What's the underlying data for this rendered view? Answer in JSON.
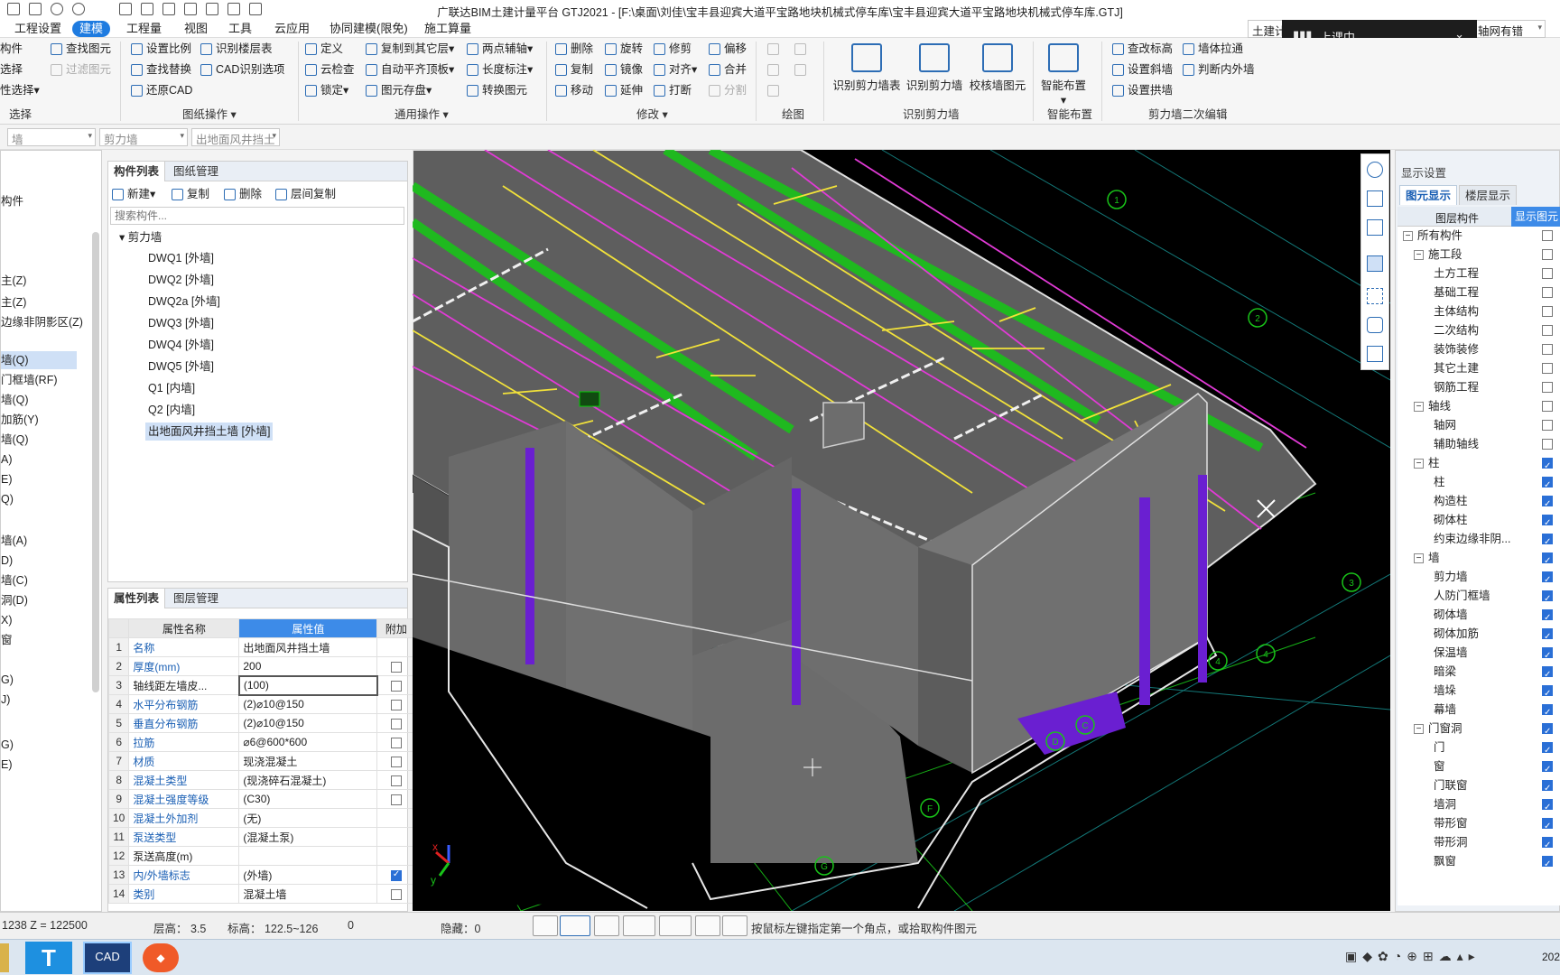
{
  "app": {
    "title": "广联达BIM土建计量平台 GTJ2021 - [F:\\桌面\\刘佳\\宝丰县迎宾大道平宝路地块机械式停车库\\宝丰县迎宾大道平宝路地块机械式停车库.GTJ]"
  },
  "menu": [
    "工程设置",
    "建模",
    "工程量",
    "视图",
    "工具",
    "云应用",
    "协同建模(限免)",
    "施工算量"
  ],
  "menu_active": "建模",
  "right_selectors": {
    "a": "土建计",
    "b": "轴网有错"
  },
  "meeting": {
    "label": "上课中"
  },
  "ribbon": {
    "select_group": {
      "items": [
        "构件",
        "选择",
        "性选择"
      ],
      "label": "选择",
      "find": "查找图元",
      "filter": "过滤图元"
    },
    "drawing_ops": {
      "items": [
        "设置比例",
        "识别楼层表",
        "查找替换",
        "CAD识别选项",
        "还原CAD"
      ],
      "label": "图纸操作"
    },
    "common_ops": {
      "items": [
        "定义",
        "复制到其它层",
        "两点辅轴",
        "云检查",
        "自动平齐顶板",
        "长度标注",
        "锁定",
        "图元存盘",
        "转换图元"
      ],
      "label": "通用操作"
    },
    "modify": {
      "items": [
        "删除",
        "旋转",
        "修剪",
        "偏移",
        "复制",
        "镜像",
        "对齐",
        "合并",
        "移动",
        "延伸",
        "打断",
        "分割"
      ],
      "label": "修改"
    },
    "draw": {
      "label": "绘图"
    },
    "identify_shear": {
      "items": [
        "识别剪力墙表",
        "识别剪力墙",
        "校核墙图元"
      ],
      "label": "识别剪力墙"
    },
    "smart": {
      "items": [
        "智能布置"
      ],
      "label": "智能布置"
    },
    "shear_edit": {
      "items": [
        "查改标高",
        "墙体拉通",
        "设置斜墙",
        "判断内外墙",
        "设置拱墙"
      ],
      "label": "剪力墙二次编辑"
    }
  },
  "selbar": {
    "s1": "墙",
    "s2": "剪力墙",
    "s3": "出地面风井挡土"
  },
  "left_nav": [
    "构件",
    "主(Z)",
    "主(Z)",
    "边缘非阴影区(Z)",
    "墙(Q)",
    "门框墙(RF)",
    "墙(Q)",
    "加筋(Y)",
    "墙(Q)",
    "A)",
    "E)",
    "Q)",
    "墙(A)",
    "D)",
    "墙(C)",
    "洞(D)",
    "X)",
    "窗",
    "G)",
    "J)",
    "G)",
    "E)"
  ],
  "component_list": {
    "tabs": [
      "构件列表",
      "图纸管理"
    ],
    "toolbar": [
      "新建",
      "复制",
      "删除",
      "层间复制"
    ],
    "search_placeholder": "搜索构件...",
    "root": "剪力墙",
    "items": [
      "DWQ1 [外墙]",
      "DWQ2 [外墙]",
      "DWQ2a [外墙]",
      "DWQ3 [外墙]",
      "DWQ4 [外墙]",
      "DWQ5 [外墙]",
      "Q1 [内墙]",
      "Q2 [内墙]",
      "出地面风井挡土墙 [外墙]"
    ],
    "selected_index": 8
  },
  "properties": {
    "tabs": [
      "属性列表",
      "图层管理"
    ],
    "headers": [
      "属性名称",
      "属性值",
      "附加"
    ],
    "rows": [
      {
        "n": "1",
        "k": "名称",
        "v": "出地面风井挡土墙",
        "blue": true,
        "cb": null
      },
      {
        "n": "2",
        "k": "厚度(mm)",
        "v": "200",
        "blue": true,
        "cb": false
      },
      {
        "n": "3",
        "k": "轴线距左墙皮...",
        "v": "(100)",
        "blue": false,
        "cb": false
      },
      {
        "n": "4",
        "k": "水平分布钢筋",
        "v": "(2)⌀10@150",
        "blue": true,
        "cb": false
      },
      {
        "n": "5",
        "k": "垂直分布钢筋",
        "v": "(2)⌀10@150",
        "blue": true,
        "cb": false
      },
      {
        "n": "6",
        "k": "拉筋",
        "v": "⌀6@600*600",
        "blue": true,
        "cb": false
      },
      {
        "n": "7",
        "k": "材质",
        "v": "现浇混凝土",
        "blue": true,
        "cb": false
      },
      {
        "n": "8",
        "k": "混凝土类型",
        "v": "(现浇碎石混凝土)",
        "blue": true,
        "cb": false
      },
      {
        "n": "9",
        "k": "混凝土强度等级",
        "v": "(C30)",
        "blue": true,
        "cb": false
      },
      {
        "n": "10",
        "k": "混凝土外加剂",
        "v": "(无)",
        "blue": true,
        "cb": null
      },
      {
        "n": "11",
        "k": "泵送类型",
        "v": "(混凝土泵)",
        "blue": true,
        "cb": null
      },
      {
        "n": "12",
        "k": "泵送高度(m)",
        "v": "",
        "blue": false,
        "cb": null
      },
      {
        "n": "13",
        "k": "内/外墙标志",
        "v": "(外墙)",
        "blue": true,
        "cb": true
      },
      {
        "n": "14",
        "k": "类别",
        "v": "混凝土墙",
        "blue": true,
        "cb": false
      }
    ]
  },
  "display_settings": {
    "title": "显示设置",
    "tabs": [
      "图元显示",
      "楼层显示"
    ],
    "headers": [
      "图层构件",
      "显示图元"
    ],
    "rows": [
      {
        "label": "所有构件",
        "level": 0,
        "exp": "−",
        "on": false
      },
      {
        "label": "施工段",
        "level": 1,
        "exp": "−",
        "on": false
      },
      {
        "label": "土方工程",
        "level": 2,
        "exp": "",
        "on": false
      },
      {
        "label": "基础工程",
        "level": 2,
        "exp": "",
        "on": false
      },
      {
        "label": "主体结构",
        "level": 2,
        "exp": "",
        "on": false
      },
      {
        "label": "二次结构",
        "level": 2,
        "exp": "",
        "on": false
      },
      {
        "label": "装饰装修",
        "level": 2,
        "exp": "",
        "on": false
      },
      {
        "label": "其它土建",
        "level": 2,
        "exp": "",
        "on": false
      },
      {
        "label": "钢筋工程",
        "level": 2,
        "exp": "",
        "on": false
      },
      {
        "label": "轴线",
        "level": 1,
        "exp": "−",
        "on": false
      },
      {
        "label": "轴网",
        "level": 2,
        "exp": "",
        "on": false
      },
      {
        "label": "辅助轴线",
        "level": 2,
        "exp": "",
        "on": false
      },
      {
        "label": "柱",
        "level": 1,
        "exp": "−",
        "on": true
      },
      {
        "label": "柱",
        "level": 2,
        "exp": "",
        "on": true
      },
      {
        "label": "构造柱",
        "level": 2,
        "exp": "",
        "on": true
      },
      {
        "label": "砌体柱",
        "level": 2,
        "exp": "",
        "on": true
      },
      {
        "label": "约束边缘非阴...",
        "level": 2,
        "exp": "",
        "on": true
      },
      {
        "label": "墙",
        "level": 1,
        "exp": "−",
        "on": true
      },
      {
        "label": "剪力墙",
        "level": 2,
        "exp": "",
        "on": true
      },
      {
        "label": "人防门框墙",
        "level": 2,
        "exp": "",
        "on": true
      },
      {
        "label": "砌体墙",
        "level": 2,
        "exp": "",
        "on": true
      },
      {
        "label": "砌体加筋",
        "level": 2,
        "exp": "",
        "on": true
      },
      {
        "label": "保温墙",
        "level": 2,
        "exp": "",
        "on": true
      },
      {
        "label": "暗梁",
        "level": 2,
        "exp": "",
        "on": true
      },
      {
        "label": "墙垛",
        "level": 2,
        "exp": "",
        "on": true
      },
      {
        "label": "幕墙",
        "level": 2,
        "exp": "",
        "on": true
      },
      {
        "label": "门窗洞",
        "level": 1,
        "exp": "−",
        "on": true
      },
      {
        "label": "门",
        "level": 2,
        "exp": "",
        "on": true
      },
      {
        "label": "窗",
        "level": 2,
        "exp": "",
        "on": true
      },
      {
        "label": "门联窗",
        "level": 2,
        "exp": "",
        "on": true
      },
      {
        "label": "墙洞",
        "level": 2,
        "exp": "",
        "on": true
      },
      {
        "label": "带形窗",
        "level": 2,
        "exp": "",
        "on": true
      },
      {
        "label": "带形洞",
        "level": 2,
        "exp": "",
        "on": true
      },
      {
        "label": "飘窗",
        "level": 2,
        "exp": "",
        "on": true
      }
    ]
  },
  "status": {
    "coords": "1238 Z = 122500",
    "floor_height": "层高： 3.5",
    "elevation": "标高： 122.5~126",
    "zero": "0",
    "hidden": "隐藏：0",
    "hint": "按鼠标左键指定第一个角点，或拾取构件图元"
  },
  "taskbar": {
    "clock": "202"
  },
  "colors": {
    "accent": "#1e7be0",
    "wall": "#6a6a6a",
    "green": "#19c319",
    "magenta": "#e13ad6",
    "yellow": "#f2e23a",
    "purple": "#6a1fd1"
  },
  "viewport_labels": [
    "1",
    "2",
    "3",
    "4",
    "4",
    "C",
    "D",
    "F",
    "G"
  ]
}
